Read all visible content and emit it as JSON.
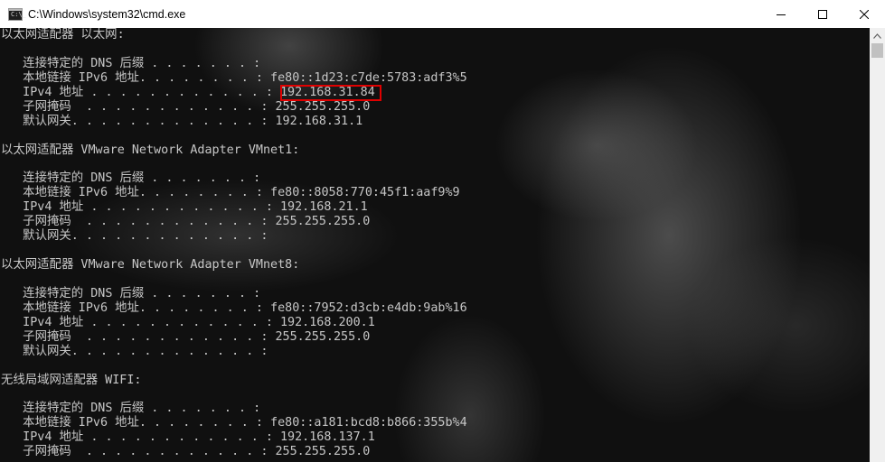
{
  "window": {
    "title": "C:\\Windows\\system32\\cmd.exe",
    "icon_text": "C:\\_"
  },
  "controls": {
    "minimize": "minimize-icon",
    "maximize": "maximize-icon",
    "close": "close-icon"
  },
  "console": {
    "lines": [
      "以太网适配器 以太网:",
      "",
      "   连接特定的 DNS 后缀 . . . . . . . :",
      "   本地链接 IPv6 地址. . . . . . . . : fe80::1d23:c7de:5783:adf3%5",
      "   IPv4 地址 . . . . . . . . . . . . : 192.168.31.84",
      "   子网掩码  . . . . . . . . . . . . : 255.255.255.0",
      "   默认网关. . . . . . . . . . . . . : 192.168.31.1",
      "",
      "以太网适配器 VMware Network Adapter VMnet1:",
      "",
      "   连接特定的 DNS 后缀 . . . . . . . :",
      "   本地链接 IPv6 地址. . . . . . . . : fe80::8058:770:45f1:aaf9%9",
      "   IPv4 地址 . . . . . . . . . . . . : 192.168.21.1",
      "   子网掩码  . . . . . . . . . . . . : 255.255.255.0",
      "   默认网关. . . . . . . . . . . . . :",
      "",
      "以太网适配器 VMware Network Adapter VMnet8:",
      "",
      "   连接特定的 DNS 后缀 . . . . . . . :",
      "   本地链接 IPv6 地址. . . . . . . . : fe80::7952:d3cb:e4db:9ab%16",
      "   IPv4 地址 . . . . . . . . . . . . : 192.168.200.1",
      "   子网掩码  . . . . . . . . . . . . : 255.255.255.0",
      "   默认网关. . . . . . . . . . . . . :",
      "",
      "无线局域网适配器 WIFI:",
      "",
      "   连接特定的 DNS 后缀 . . . . . . . :",
      "   本地链接 IPv6 地址. . . . . . . . : fe80::a181:bcd8:b866:355b%4",
      "   IPv4 地址 . . . . . . . . . . . . : 192.168.137.1",
      "   子网掩码  . . . . . . . . . . . . : 255.255.255.0"
    ]
  },
  "colors": {
    "highlight_border": "#e00000",
    "console_text": "#c7c7c7",
    "titlebar_bg": "#ffffff"
  }
}
